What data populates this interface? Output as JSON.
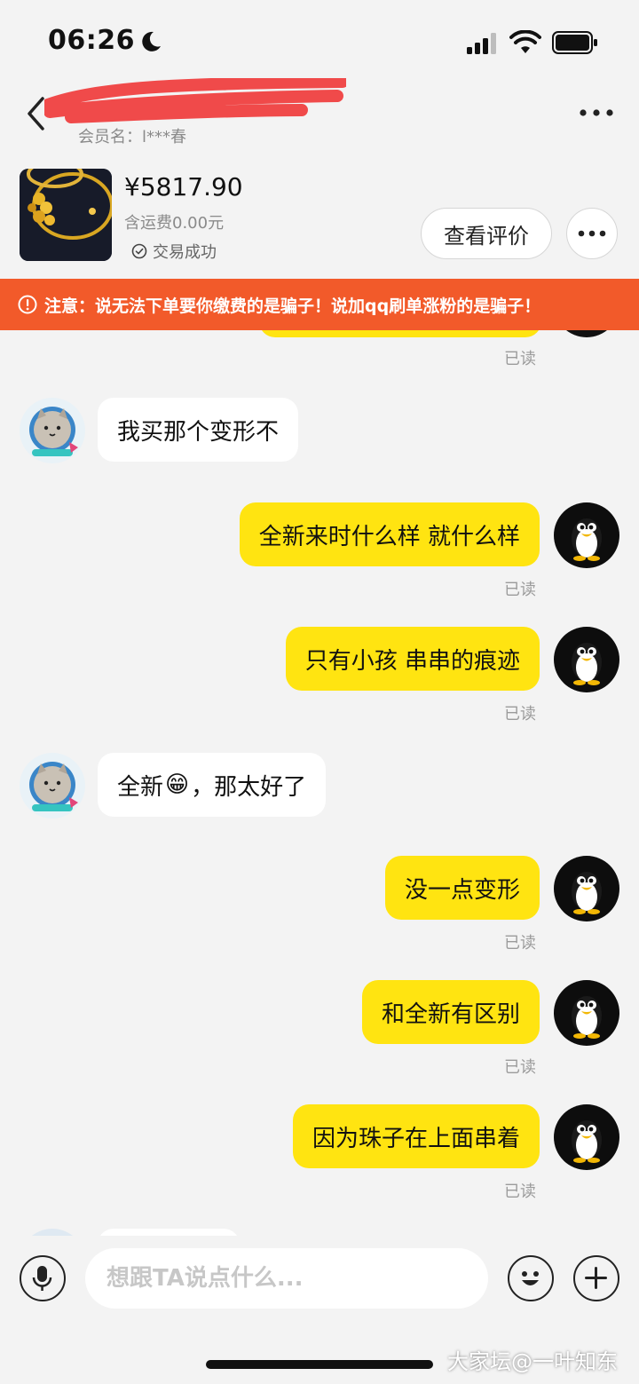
{
  "status_bar": {
    "time": "06:26"
  },
  "header": {
    "shop_name": "**** ******",
    "member_label": "会员名：l***春"
  },
  "product": {
    "price": "¥5817.90",
    "shipping": "含运费0.00元",
    "status": "交易成功",
    "review_button": "查看评价"
  },
  "banner": {
    "text": "注意：说无法下单要你缴费的是骗子！说加qq刷单涨粉的是骗子！"
  },
  "messages": [
    {
      "from": "me",
      "text": "",
      "read": "已读"
    },
    {
      "from": "them",
      "text": "我买那个变形不"
    },
    {
      "from": "me",
      "text": "全新来时什么样 就什么样",
      "read": "已读"
    },
    {
      "from": "me",
      "text": "只有小孩 串串的痕迹",
      "read": "已读"
    },
    {
      "from": "them",
      "text_before": "全新",
      "emoji": "😁",
      "text_after": "，那太好了"
    },
    {
      "from": "me",
      "text": "没一点变形",
      "read": "已读"
    },
    {
      "from": "me",
      "text": "和全新有区别",
      "read": "已读"
    },
    {
      "from": "me",
      "text": "因为珠子在上面串着",
      "read": "已读"
    }
  ],
  "input_bar": {
    "placeholder": "想跟TA说点什么..."
  },
  "watermark": "大家坛@一叶知东",
  "colors": {
    "accent_yellow": "#ffe411",
    "banner_orange": "#f25a2a",
    "background": "#f3f3f3"
  },
  "icons": [
    "moon-icon",
    "signal-icon",
    "wifi-icon",
    "battery-icon",
    "back-icon",
    "more-icon",
    "check-circle-icon",
    "warning-icon",
    "mic-icon",
    "emoji-icon",
    "plus-icon"
  ]
}
